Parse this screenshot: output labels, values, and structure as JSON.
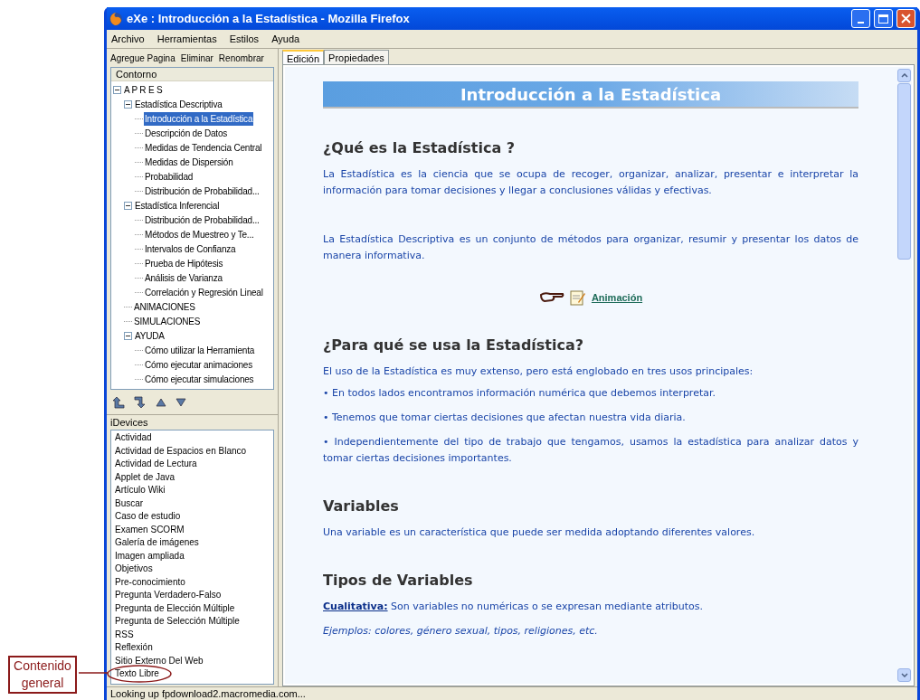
{
  "window": {
    "title": "eXe : Introducción a la Estadística - Mozilla Firefox"
  },
  "menu": [
    "Archivo",
    "Herramientas",
    "Estilos",
    "Ayuda"
  ],
  "outline_toolbar": [
    "Agregue Pagina",
    "Eliminar",
    "Renombrar"
  ],
  "outline": {
    "title": "Contorno",
    "items": [
      {
        "label": "A P R E S",
        "expanded": true,
        "selected": false,
        "children": [
          {
            "label": "Estadística Descriptiva",
            "expanded": true,
            "selected": false,
            "children": [
              {
                "label": "Introducción a la Estadística",
                "selected": true
              },
              {
                "label": "Descripción de Datos",
                "selected": false
              },
              {
                "label": "Medidas de Tendencia Central",
                "selected": false
              },
              {
                "label": "Medidas de Dispersión",
                "selected": false
              },
              {
                "label": "Probabilidad",
                "selected": false
              },
              {
                "label": "Distribución de Probabilidad...",
                "selected": false
              }
            ]
          },
          {
            "label": "Estadística Inferencial",
            "expanded": true,
            "selected": false,
            "children": [
              {
                "label": "Distribución de Probabilidad...",
                "selected": false
              },
              {
                "label": "Métodos de Muestreo y Te...",
                "selected": false
              },
              {
                "label": "Intervalos de Confianza",
                "selected": false
              },
              {
                "label": "Prueba de Hipótesis",
                "selected": false
              },
              {
                "label": "Análisis de Varianza",
                "selected": false
              },
              {
                "label": "Correlación y Regresión Lineal",
                "selected": false
              }
            ]
          },
          {
            "label": "ANIMACIONES",
            "selected": false
          },
          {
            "label": "SIMULACIONES",
            "selected": false
          },
          {
            "label": "AYUDA",
            "expanded": true,
            "selected": false,
            "children": [
              {
                "label": "Cómo utilizar la Herramienta",
                "selected": false
              },
              {
                "label": "Cómo ejecutar animaciones",
                "selected": false
              },
              {
                "label": "Cómo ejecutar simulaciones",
                "selected": false
              }
            ]
          }
        ]
      }
    ]
  },
  "idevices": {
    "title": "iDevices",
    "items": [
      "Actividad",
      "Actividad de Espacios en Blanco",
      "Actividad de Lectura",
      "Applet de Java",
      "Artículo Wiki",
      "Buscar",
      "Caso de estudio",
      "Examen SCORM",
      "Galería de imágenes",
      "Imagen ampliada",
      "Objetivos",
      "Pre-conocimiento",
      "Pregunta Verdadero-Falso",
      "Pregunta de Elección Múltiple",
      "Pregunta de Selección Múltiple",
      "RSS",
      "Reflexión",
      "Sitio Externo Del Web",
      "Texto Libre"
    ]
  },
  "tabs": [
    {
      "label": "Edición",
      "selected": true
    },
    {
      "label": "Propiedades",
      "selected": false
    }
  ],
  "content": {
    "title": "Introducción a la Estadística",
    "sections": [
      {
        "heading": "¿Qué es la Estadística ?",
        "blocks": [
          {
            "kind": "paragraph",
            "text": "La Estadística es la ciencia que se ocupa de recoger, organizar, analizar, presentar e interpretar la información para tomar decisiones y llegar a conclusiones válidas y efectivas."
          },
          {
            "kind": "paragraph",
            "text": "La Estadística Descriptiva es un conjunto de métodos para organizar, resumir y presentar los datos de manera informativa."
          },
          {
            "kind": "link",
            "text": "Animación"
          }
        ]
      },
      {
        "heading": "¿Para qué se usa la Estadística?",
        "blocks": [
          {
            "kind": "paragraph",
            "text": "El uso de la Estadística es muy extenso, pero está englobado en tres usos principales:"
          },
          {
            "kind": "bullet",
            "text": "• En todos lados encontramos información numérica que debemos interpretar."
          },
          {
            "kind": "bullet",
            "text": "• Tenemos que tomar ciertas decisiones que afectan nuestra vida diaria."
          },
          {
            "kind": "bullet",
            "text": "• Independientemente del tipo de trabajo que tengamos, usamos la estadística para analizar datos y tomar ciertas decisiones importantes."
          }
        ]
      },
      {
        "heading": "Variables",
        "blocks": [
          {
            "kind": "paragraph",
            "text": "Una variable es un característica que puede ser medida adoptando diferentes valores."
          }
        ]
      },
      {
        "heading": "Tipos de Variables",
        "blocks": [
          {
            "kind": "definition",
            "term": "Cualitativa:",
            "text": "Son variables no numéricas o se expresan mediante atributos."
          },
          {
            "kind": "example",
            "text": "Ejemplos: colores, género sexual, tipos, religiones, etc."
          }
        ]
      }
    ]
  },
  "status_bar": "Looking up fpdownload2.macromedia.com...",
  "annotation": {
    "lines": [
      "Contenido",
      "general"
    ]
  }
}
